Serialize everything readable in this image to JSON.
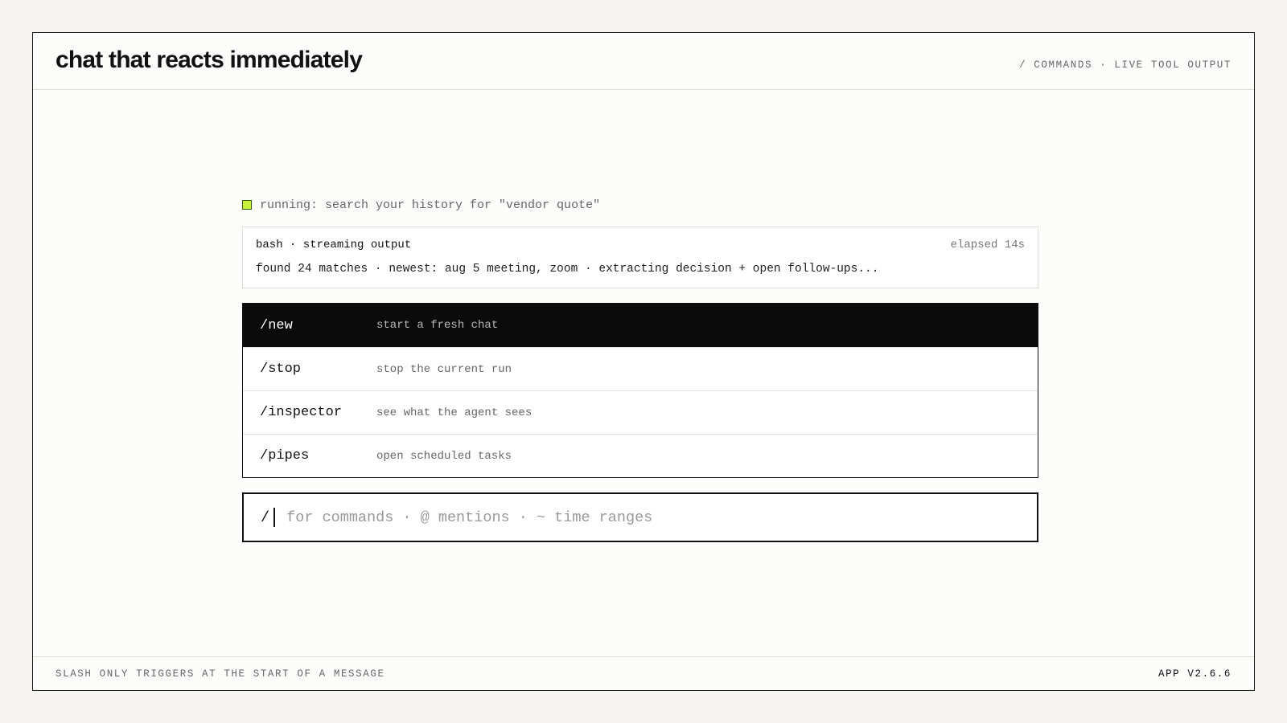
{
  "header": {
    "title": "chat that reacts immediately",
    "meta": "/ COMMANDS · LIVE TOOL OUTPUT"
  },
  "status": {
    "text": "running: search your history for \"vendor quote\"",
    "dot_color": "#c6f23a"
  },
  "tool_card": {
    "title": "bash · streaming output",
    "elapsed": "elapsed 14s",
    "output": "found 24 matches · newest: aug 5 meeting, zoom · extracting decision + open follow-ups..."
  },
  "commands": [
    {
      "name": "/new",
      "description": "start a fresh chat",
      "selected": true
    },
    {
      "name": "/stop",
      "description": "stop the current run",
      "selected": false
    },
    {
      "name": "/inspector",
      "description": "see what the agent sees",
      "selected": false
    },
    {
      "name": "/pipes",
      "description": "open scheduled tasks",
      "selected": false
    }
  ],
  "composer": {
    "value": "/",
    "placeholder": "for commands · @ mentions · ~ time ranges"
  },
  "footer": {
    "note": "SLASH ONLY TRIGGERS AT THE START OF A MESSAGE",
    "version": "APP V2.6.6"
  }
}
